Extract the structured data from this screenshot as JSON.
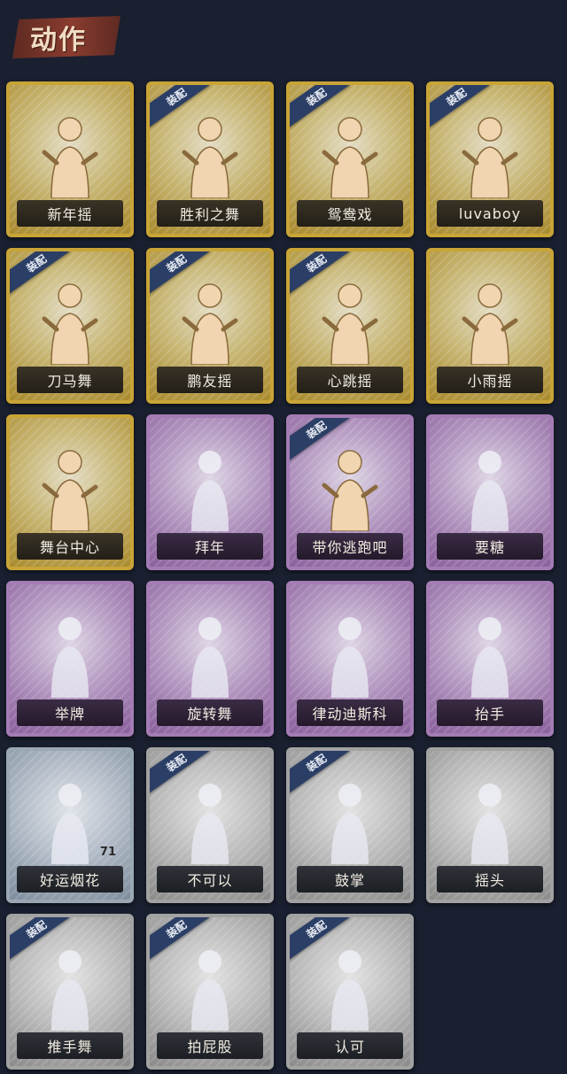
{
  "header": {
    "title": "动作"
  },
  "equip_label": "装配",
  "cards": [
    {
      "label": "新年摇",
      "rarity": "gold",
      "equipped": false,
      "icon": "dance-figure-icon"
    },
    {
      "label": "胜利之舞",
      "rarity": "gold",
      "equipped": true,
      "icon": "victory-pose-icon"
    },
    {
      "label": "鸳鸯戏",
      "rarity": "gold",
      "equipped": true,
      "icon": "dance-figure-icon"
    },
    {
      "label": "luvaboy",
      "rarity": "gold",
      "equipped": true,
      "icon": "dance-figure-icon"
    },
    {
      "label": "刀马舞",
      "rarity": "gold",
      "equipped": true,
      "icon": "dance-figure-icon"
    },
    {
      "label": "鹏友摇",
      "rarity": "gold",
      "equipped": true,
      "icon": "dance-figure-icon"
    },
    {
      "label": "心跳摇",
      "rarity": "gold",
      "equipped": true,
      "icon": "dance-figure-icon"
    },
    {
      "label": "小雨摇",
      "rarity": "gold",
      "equipped": false,
      "icon": "dance-figure-icon"
    },
    {
      "label": "舞台中心",
      "rarity": "gold",
      "equipped": false,
      "icon": "dance-figure-icon"
    },
    {
      "label": "拜年",
      "rarity": "purple",
      "equipped": false,
      "icon": "bow-figure-icon"
    },
    {
      "label": "带你逃跑吧",
      "rarity": "purple",
      "equipped": true,
      "icon": "dance-figure-icon"
    },
    {
      "label": "要糖",
      "rarity": "purple",
      "equipped": false,
      "icon": "reach-figure-icon"
    },
    {
      "label": "举牌",
      "rarity": "purple",
      "equipped": false,
      "icon": "sign-figure-icon"
    },
    {
      "label": "旋转舞",
      "rarity": "purple",
      "equipped": false,
      "icon": "spin-figure-icon"
    },
    {
      "label": "律动迪斯科",
      "rarity": "purple",
      "equipped": false,
      "icon": "disco-figure-icon"
    },
    {
      "label": "抬手",
      "rarity": "purple",
      "equipped": false,
      "icon": "raise-hand-icon"
    },
    {
      "label": "好运烟花",
      "rarity": "blue",
      "equipped": false,
      "icon": "firework-icon",
      "count": "71"
    },
    {
      "label": "不可以",
      "rarity": "grey",
      "equipped": true,
      "icon": "finger-wag-icon"
    },
    {
      "label": "鼓掌",
      "rarity": "grey",
      "equipped": true,
      "icon": "clap-icon"
    },
    {
      "label": "摇头",
      "rarity": "grey",
      "equipped": false,
      "icon": "head-shake-icon"
    },
    {
      "label": "推手舞",
      "rarity": "grey",
      "equipped": true,
      "icon": "push-dance-icon"
    },
    {
      "label": "拍屁股",
      "rarity": "grey",
      "equipped": true,
      "icon": "pat-figure-icon"
    },
    {
      "label": "认可",
      "rarity": "grey",
      "equipped": true,
      "icon": "thumbs-up-icon"
    }
  ],
  "colors": {
    "background": "#1a2030",
    "gold": "#c9a436",
    "purple": "#a47cb4",
    "blue": "#9aa7b4",
    "grey": "#a2a2a2",
    "equip_tag": "#2b3e66"
  }
}
